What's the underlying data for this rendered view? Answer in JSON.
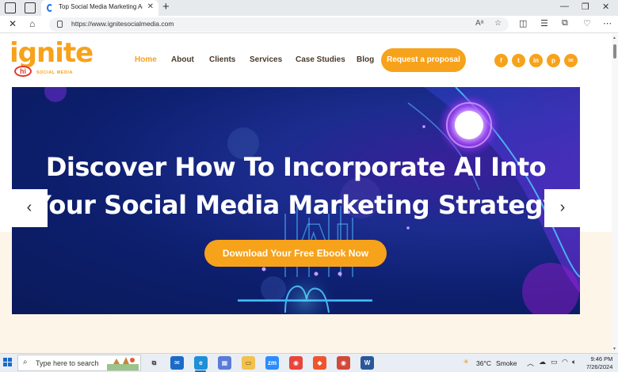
{
  "browser": {
    "tab_title": "Top Social Media Marketing Age",
    "url": "https://www.ignitesocialmedia.com",
    "reader_label": "Aᵃ"
  },
  "site": {
    "logo": {
      "word": "ignite",
      "badge": "hi",
      "tagline": "SOCIAL MEDIA"
    },
    "nav": [
      {
        "label": "Home",
        "active": true
      },
      {
        "label": "About"
      },
      {
        "label": "Clients"
      },
      {
        "label": "Services"
      },
      {
        "label": "Case Studies"
      },
      {
        "label": "Blog"
      }
    ],
    "cta_label": "Request a proposal",
    "social_icons": [
      "facebook-icon",
      "twitter-icon",
      "linkedin-icon",
      "pinterest-icon",
      "email-icon"
    ],
    "hero": {
      "title_line1": "Discover How To Incorporate AI Into",
      "title_line2": "Your Social Media Marketing Strategy",
      "button_label": "Download Your Free Ebook Now",
      "ai_letters": "AI"
    },
    "colors": {
      "brand_orange": "#f7a21b",
      "hero_blue": "#0d1f6e",
      "cream": "#fdf5e8"
    }
  },
  "taskbar": {
    "search_placeholder": "Type here to search",
    "weather_temp": "36°C",
    "weather_desc": "Smoke",
    "time": "9:46 PM",
    "date": "7/26/2024",
    "apps": [
      "task-view",
      "mail",
      "edge",
      "store",
      "file-explorer",
      "zoom",
      "chrome",
      "brave",
      "chrome-profile",
      "word"
    ]
  }
}
